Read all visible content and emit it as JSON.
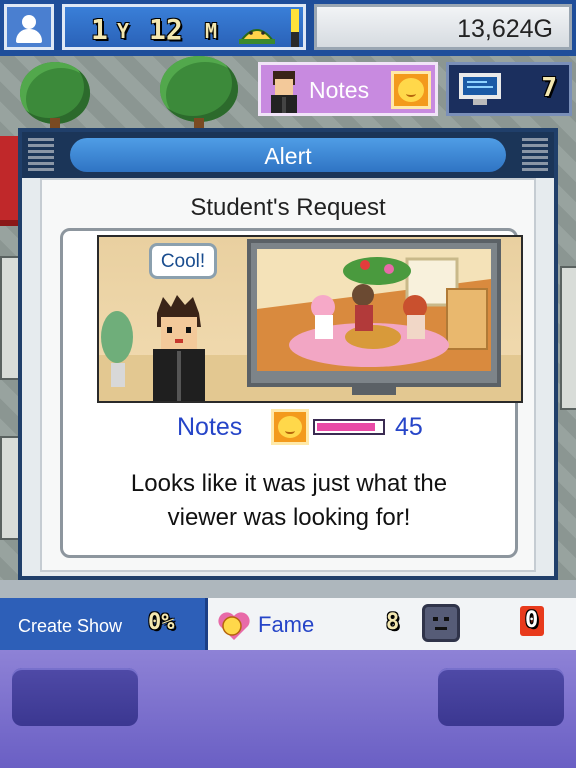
{
  "header": {
    "date_years": "1",
    "date_years_unit": "Y",
    "date_months": "12",
    "date_months_unit": "M",
    "money": "13,624G",
    "weather_icon": "sun-icon"
  },
  "notes_badge": {
    "label": "Notes",
    "icon": "smiley-icon"
  },
  "monitor": {
    "count": "7",
    "icon": "monitor-icon"
  },
  "dialog": {
    "title": "Alert",
    "request_title": "Student's Request",
    "speech": "Cool!",
    "notes_label": "Notes",
    "notes_value": "45",
    "notes_fill_fraction": 0.9,
    "message": "Looks like it was just what the viewer was looking for!"
  },
  "bottom_bar": {
    "create_show_label": "Create Show",
    "create_show_pct": "0%",
    "fame_label": "Fame",
    "fame_count": "8",
    "alert_count": "0"
  },
  "colors": {
    "accent_blue": "#2d5fb8",
    "notes_pink": "#e94aa6",
    "text_blue": "#2645c8"
  }
}
